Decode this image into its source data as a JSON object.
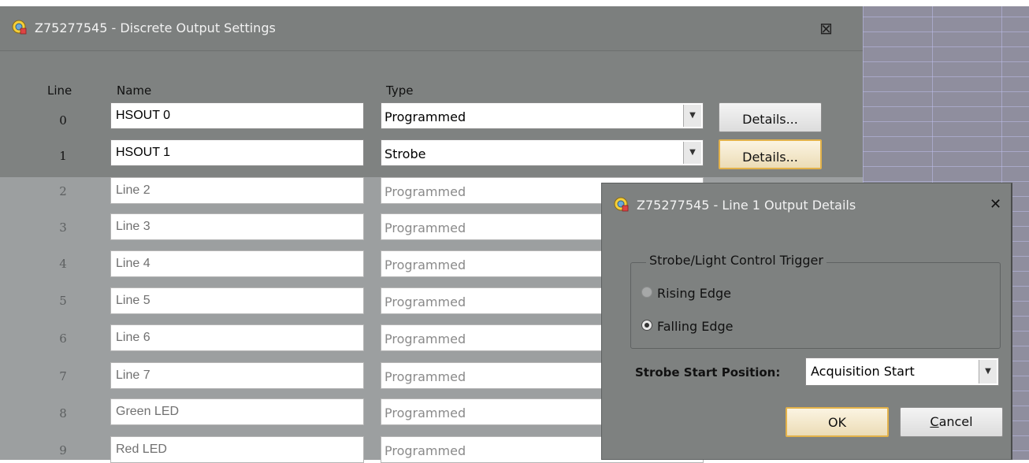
{
  "main_window": {
    "title": "Z75277545 - Discrete Output Settings",
    "close_glyph": "⊠"
  },
  "headers": {
    "line": "Line",
    "name": "Name",
    "type": "Type"
  },
  "rows": [
    {
      "line": "0",
      "name": "HSOUT 0",
      "type": "Programmed",
      "details": "Details..."
    },
    {
      "line": "1",
      "name": "HSOUT 1",
      "type": "Strobe",
      "details": "Details..."
    },
    {
      "line": "2",
      "name": "Line 2",
      "type": "Programmed"
    },
    {
      "line": "3",
      "name": "Line 3",
      "type": "Programmed"
    },
    {
      "line": "4",
      "name": "Line 4",
      "type": "Programmed"
    },
    {
      "line": "5",
      "name": "Line 5",
      "type": "Programmed"
    },
    {
      "line": "6",
      "name": "Line 6",
      "type": "Programmed"
    },
    {
      "line": "7",
      "name": "Line 7",
      "type": "Programmed"
    },
    {
      "line": "8",
      "name": "Green LED",
      "type": "Programmed"
    },
    {
      "line": "9",
      "name": "Red LED",
      "type": "Programmed"
    }
  ],
  "dialog": {
    "title": "Z75277545 - Line 1 Output Details",
    "close_glyph": "✕",
    "group_label": "Strobe/Light Control Trigger",
    "rising_edge": "Rising Edge",
    "falling_edge": "Falling Edge",
    "selected_trigger": "Falling Edge",
    "strobe_start_label": "Strobe Start Position:",
    "strobe_start_value": "Acquisition Start",
    "ok_label": "OK",
    "cancel_first": "C",
    "cancel_rest": "ancel"
  },
  "icons": {
    "app_icon": "camera-settings-icon",
    "dropdown_arrow": "chevron-down-icon"
  },
  "colors": {
    "focus_border": "#e3b24a",
    "window_bg": "#7f8281"
  }
}
